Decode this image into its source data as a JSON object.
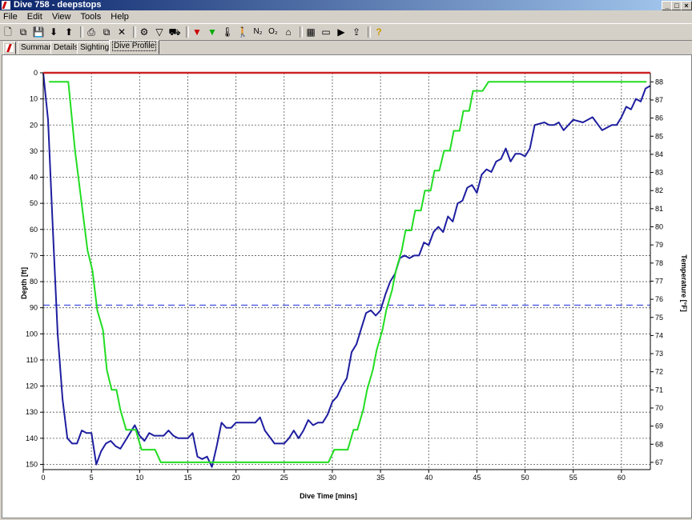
{
  "window": {
    "title": "Dive 758 - deepstops",
    "minimize": "_",
    "maximize": "□",
    "close": "×"
  },
  "menu": [
    "File",
    "Edit",
    "View",
    "Tools",
    "Help"
  ],
  "toolbar": [
    {
      "icon": "new-icon",
      "glyph": "🗋"
    },
    {
      "icon": "copy-icon",
      "glyph": "⧉"
    },
    {
      "icon": "save-icon",
      "glyph": "💾"
    },
    {
      "icon": "download-icon",
      "glyph": "⬇"
    },
    {
      "icon": "upload-icon",
      "glyph": "⬆"
    },
    {
      "sep": true
    },
    {
      "icon": "print-icon",
      "glyph": "⎙"
    },
    {
      "icon": "copy-page-icon",
      "glyph": "⧉"
    },
    {
      "icon": "delete-icon",
      "glyph": "✕"
    },
    {
      "sep": true
    },
    {
      "icon": "dive-computer-icon",
      "glyph": "⚙"
    },
    {
      "icon": "filter-icon",
      "glyph": "▽"
    },
    {
      "icon": "car-icon",
      "glyph": "⛟"
    },
    {
      "sep": true
    },
    {
      "icon": "depth-marker-red-icon",
      "glyph": "▼"
    },
    {
      "icon": "depth-marker-green-icon",
      "glyph": "▼"
    },
    {
      "icon": "thermometer-icon",
      "glyph": "🌡"
    },
    {
      "icon": "diver-icon",
      "glyph": "🚶"
    },
    {
      "icon": "nitrogen-icon",
      "glyph": "N₂"
    },
    {
      "icon": "oxygen-icon",
      "glyph": "O₂"
    },
    {
      "icon": "tank-icon",
      "glyph": "⌂"
    },
    {
      "sep": true
    },
    {
      "icon": "grid-icon",
      "glyph": "▦"
    },
    {
      "icon": "monitor-icon",
      "glyph": "▭"
    },
    {
      "icon": "play-icon",
      "glyph": "▶"
    },
    {
      "icon": "export-icon",
      "glyph": "⇪"
    },
    {
      "sep": true
    },
    {
      "icon": "help-icon",
      "glyph": "?"
    }
  ],
  "tabs": [
    {
      "label": "Summary",
      "active": false
    },
    {
      "label": "Details",
      "active": false
    },
    {
      "label": "Sightings",
      "active": false
    },
    {
      "label": "Dive Profile",
      "active": true
    }
  ],
  "colors": {
    "depth": "#1e1ea0",
    "temperature": "#22dd22",
    "max_line": "#cc2222",
    "ref_line": "#3344dd"
  },
  "chart_data": {
    "type": "line",
    "xlabel": "Dive Time [mins]",
    "ylabel": "Depth [ft]",
    "y2label": "Temperature [°F]",
    "xlim": [
      0,
      63
    ],
    "ylim": [
      0,
      152
    ],
    "y2lim": [
      66.6,
      88.5
    ],
    "xticks": [
      0,
      5,
      10,
      15,
      20,
      25,
      30,
      35,
      40,
      45,
      50,
      55,
      60
    ],
    "yticks": [
      0,
      10,
      20,
      30,
      40,
      50,
      60,
      70,
      80,
      90,
      100,
      110,
      120,
      130,
      140,
      150
    ],
    "y2ticks": [
      67,
      68,
      69,
      70,
      71,
      72,
      73,
      74,
      75,
      76,
      77,
      78,
      79,
      80,
      81,
      82,
      83,
      84,
      85,
      86,
      87,
      88
    ],
    "grid": true,
    "reference_depth_ft": 89,
    "series": [
      {
        "role": "depth",
        "points": [
          [
            0,
            0
          ],
          [
            0.5,
            18
          ],
          [
            1,
            60
          ],
          [
            1.5,
            100
          ],
          [
            2,
            125
          ],
          [
            2.5,
            140
          ],
          [
            3,
            142
          ],
          [
            3.5,
            142
          ],
          [
            4,
            137
          ],
          [
            4.5,
            138
          ],
          [
            5,
            138
          ],
          [
            5.5,
            150
          ],
          [
            6,
            145
          ],
          [
            6.5,
            142
          ],
          [
            7,
            141
          ],
          [
            7.5,
            143
          ],
          [
            8,
            144
          ],
          [
            8.5,
            141
          ],
          [
            9,
            138
          ],
          [
            9.5,
            135
          ],
          [
            10,
            139
          ],
          [
            10.5,
            141
          ],
          [
            11,
            138
          ],
          [
            11.5,
            139
          ],
          [
            12,
            139
          ],
          [
            12.5,
            139
          ],
          [
            13,
            137
          ],
          [
            13.5,
            139
          ],
          [
            14,
            140
          ],
          [
            15,
            140
          ],
          [
            15.5,
            138
          ],
          [
            16,
            147
          ],
          [
            16.5,
            148
          ],
          [
            17,
            147
          ],
          [
            17.5,
            151
          ],
          [
            18,
            143
          ],
          [
            18.5,
            134
          ],
          [
            19,
            136
          ],
          [
            19.5,
            136
          ],
          [
            20,
            134
          ],
          [
            21,
            134
          ],
          [
            22,
            134
          ],
          [
            22.5,
            132
          ],
          [
            23,
            137
          ],
          [
            24,
            142
          ],
          [
            25,
            142
          ],
          [
            25.5,
            140
          ],
          [
            26,
            137
          ],
          [
            26.5,
            140
          ],
          [
            27,
            137
          ],
          [
            27.5,
            133
          ],
          [
            28,
            135
          ],
          [
            28.5,
            134
          ],
          [
            29,
            134
          ],
          [
            29.5,
            131
          ],
          [
            30,
            126
          ],
          [
            30.5,
            124
          ],
          [
            31,
            120
          ],
          [
            31.5,
            117
          ],
          [
            32,
            107
          ],
          [
            32.5,
            104
          ],
          [
            33,
            98
          ],
          [
            33.5,
            92
          ],
          [
            34,
            91
          ],
          [
            34.5,
            93
          ],
          [
            35,
            91
          ],
          [
            35.5,
            85
          ],
          [
            36,
            80
          ],
          [
            36.5,
            77
          ],
          [
            37,
            71
          ],
          [
            37.5,
            70
          ],
          [
            38,
            71
          ],
          [
            38.5,
            70
          ],
          [
            39,
            70
          ],
          [
            39.5,
            65
          ],
          [
            40,
            66
          ],
          [
            40.5,
            61
          ],
          [
            41,
            59
          ],
          [
            41.5,
            61
          ],
          [
            42,
            55
          ],
          [
            42.5,
            57
          ],
          [
            43,
            50
          ],
          [
            43.5,
            49
          ],
          [
            44,
            44
          ],
          [
            44.5,
            43
          ],
          [
            45,
            46
          ],
          [
            45.5,
            39
          ],
          [
            46,
            37
          ],
          [
            46.5,
            38
          ],
          [
            47,
            34
          ],
          [
            47.5,
            33
          ],
          [
            48,
            29
          ],
          [
            48.5,
            34
          ],
          [
            49,
            31
          ],
          [
            49.5,
            31
          ],
          [
            50,
            32
          ],
          [
            50.5,
            29
          ],
          [
            51,
            20
          ],
          [
            52,
            19
          ],
          [
            52.5,
            20
          ],
          [
            53,
            20
          ],
          [
            53.5,
            19
          ],
          [
            54,
            22
          ],
          [
            55,
            18
          ],
          [
            56,
            19
          ],
          [
            57,
            17
          ],
          [
            58,
            22
          ],
          [
            58.5,
            21
          ],
          [
            59,
            20
          ],
          [
            59.5,
            20
          ],
          [
            60,
            17
          ],
          [
            60.5,
            13
          ],
          [
            61,
            14
          ],
          [
            61.5,
            10
          ],
          [
            62,
            11
          ],
          [
            62.5,
            6
          ],
          [
            63,
            5
          ]
        ]
      },
      {
        "role": "temperature",
        "points": [
          [
            0.6,
            88
          ],
          [
            2.6,
            88
          ],
          [
            3.3,
            84.2
          ],
          [
            4.6,
            78.7
          ],
          [
            5.1,
            77.6
          ],
          [
            5.6,
            75.4
          ],
          [
            6.2,
            74.3
          ],
          [
            6.6,
            72.1
          ],
          [
            7.1,
            71
          ],
          [
            7.6,
            71
          ],
          [
            8,
            69.9
          ],
          [
            8.6,
            68.8
          ],
          [
            9.6,
            68.8
          ],
          [
            10.2,
            67.7
          ],
          [
            11.6,
            67.7
          ],
          [
            12.2,
            67
          ],
          [
            29.6,
            67
          ],
          [
            30.2,
            67.7
          ],
          [
            31.6,
            67.7
          ],
          [
            32.2,
            68.8
          ],
          [
            32.6,
            68.8
          ],
          [
            33.2,
            69.9
          ],
          [
            33.6,
            71
          ],
          [
            34.2,
            72.1
          ],
          [
            34.6,
            73.2
          ],
          [
            35.2,
            74.3
          ],
          [
            35.6,
            75.4
          ],
          [
            36.2,
            76.5
          ],
          [
            36.6,
            77.6
          ],
          [
            37.2,
            78.7
          ],
          [
            37.6,
            79.8
          ],
          [
            38.2,
            79.8
          ],
          [
            38.6,
            80.9
          ],
          [
            39.2,
            80.9
          ],
          [
            39.6,
            82
          ],
          [
            40.2,
            82
          ],
          [
            40.6,
            83.1
          ],
          [
            41.1,
            83.1
          ],
          [
            41.6,
            84.2
          ],
          [
            42.2,
            84.2
          ],
          [
            42.6,
            85.3
          ],
          [
            43.2,
            85.3
          ],
          [
            43.6,
            86.4
          ],
          [
            44.2,
            86.4
          ],
          [
            44.6,
            87.5
          ],
          [
            45.6,
            87.5
          ],
          [
            46.2,
            88
          ],
          [
            62.6,
            88
          ]
        ]
      }
    ]
  }
}
